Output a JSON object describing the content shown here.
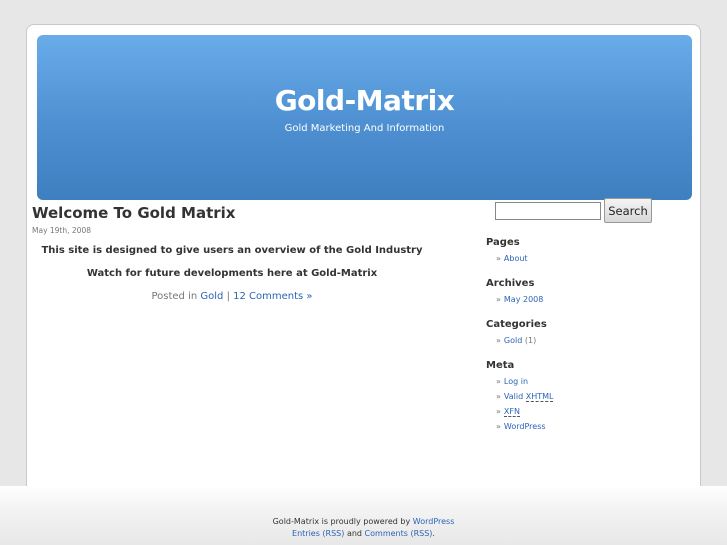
{
  "header": {
    "title": "Gold-Matrix",
    "description": "Gold Marketing And Information"
  },
  "post": {
    "title": "Welcome To Gold Matrix",
    "date": "May 19th, 2008",
    "paragraphs": [
      "This site is designed to give users an overview of the Gold Industry",
      "Watch for future developments here at Gold-Matrix"
    ],
    "posted_in_label": "Posted in",
    "category": "Gold",
    "separator": "|",
    "comments": "12 Comments »"
  },
  "search": {
    "value": "",
    "button_label": "Search"
  },
  "sidebar": {
    "pages": {
      "heading": "Pages",
      "items": [
        "About"
      ]
    },
    "archives": {
      "heading": "Archives",
      "items": [
        "May 2008"
      ]
    },
    "categories": {
      "heading": "Categories",
      "items": [
        {
          "label": "Gold",
          "count": "(1)"
        }
      ]
    },
    "meta": {
      "heading": "Meta",
      "login": "Log in",
      "valid_prefix": "Valid",
      "xhtml": "XHTML",
      "xfn": "XFN",
      "wordpress": "WordPress"
    },
    "bullet": "»"
  },
  "footer": {
    "line1_prefix": "Gold-Matrix is proudly powered by",
    "wordpress": "WordPress",
    "entries_rss": "Entries (RSS)",
    "and": "and",
    "comments_rss": "Comments (RSS)",
    "period": "."
  },
  "colors": {
    "header_top": "#69acea",
    "header_bottom": "#3d7fbf",
    "link": "#2a64b7"
  }
}
